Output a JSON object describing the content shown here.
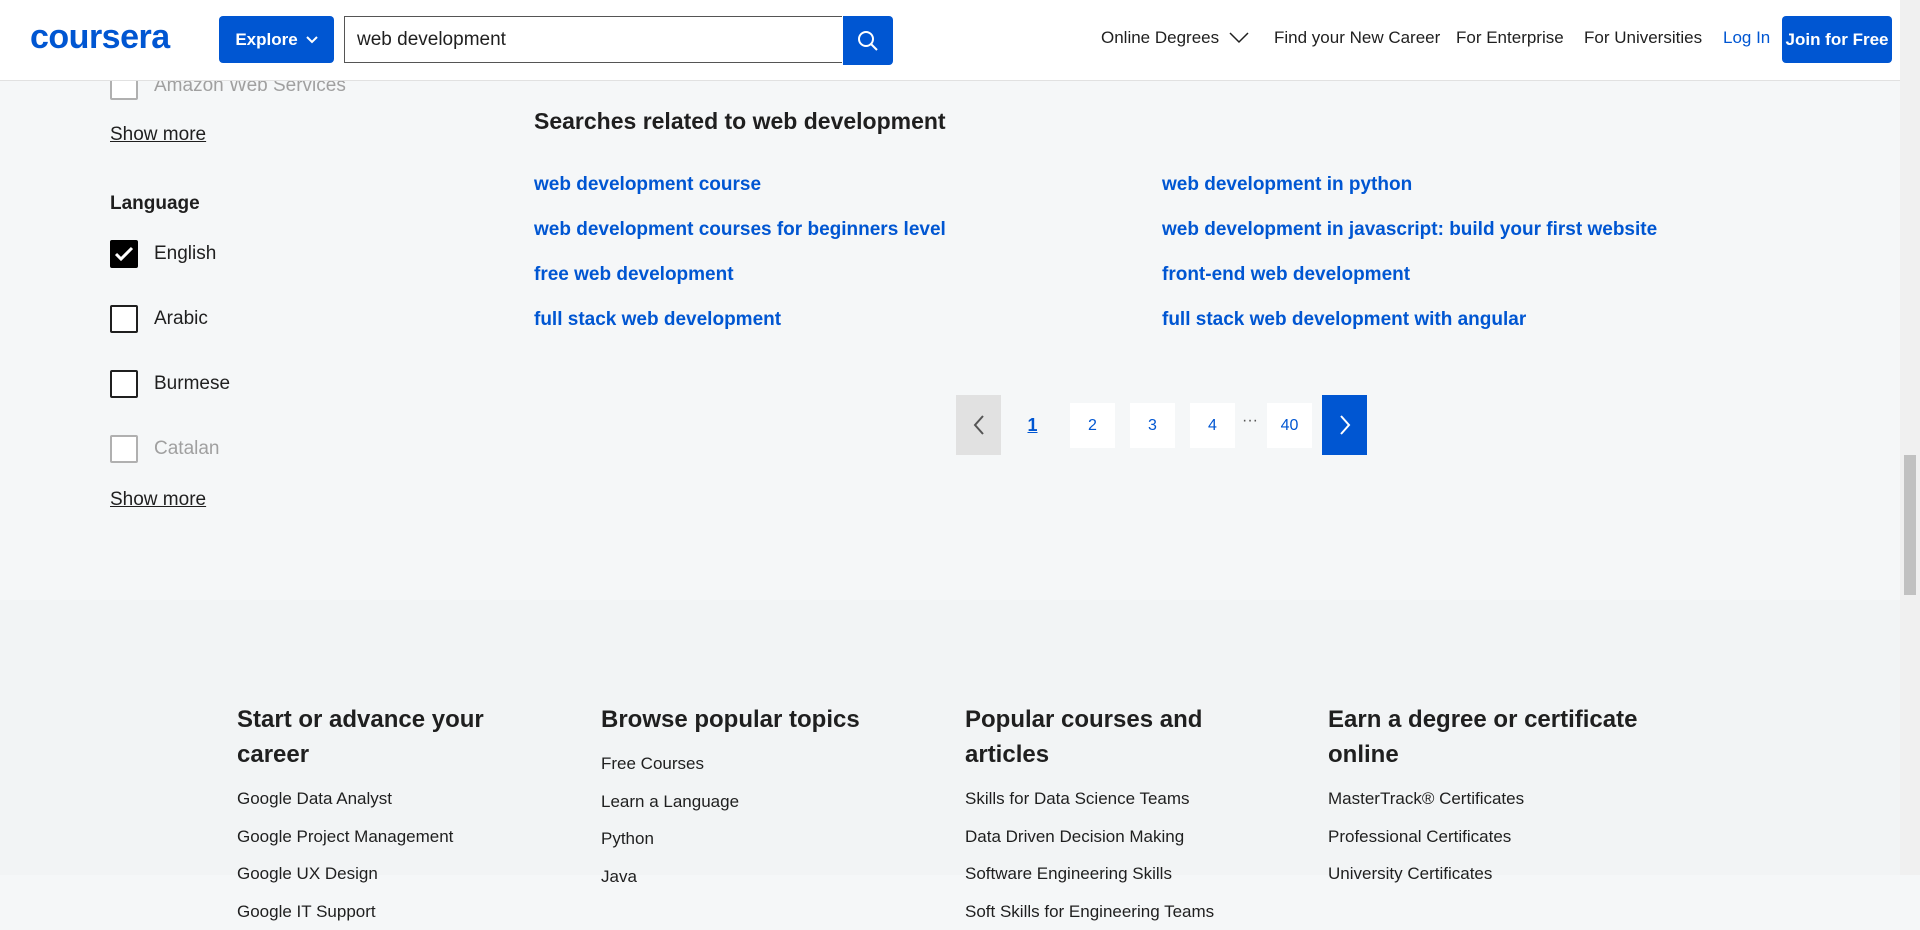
{
  "header": {
    "logo": "coursera",
    "explore_label": "Explore",
    "search_value": "web development",
    "nav": {
      "online_degrees": "Online Degrees",
      "find_career": "Find your New Career",
      "enterprise": "For Enterprise",
      "universities": "For Universities",
      "login": "Log In",
      "join": "Join for Free"
    }
  },
  "sidebar": {
    "partner_partial": "Amazon Web Services",
    "show_more_1": "Show more",
    "language_heading": "Language",
    "languages": [
      {
        "label": "English",
        "checked": true
      },
      {
        "label": "Arabic",
        "checked": false
      },
      {
        "label": "Burmese",
        "checked": false
      },
      {
        "label": "Catalan",
        "checked": false
      }
    ],
    "show_more_2": "Show more"
  },
  "related": {
    "title": "Searches related to web development",
    "left": [
      "web development course",
      "web development courses for beginners level",
      "free web development",
      "full stack web development"
    ],
    "right": [
      "web development in python",
      "web development in javascript: build your first website",
      "front-end web development",
      "full stack web development with angular"
    ]
  },
  "pagination": {
    "pages": [
      "1",
      "2",
      "3",
      "4"
    ],
    "ellipsis": "···",
    "last": "40",
    "current": "1"
  },
  "footer": {
    "columns": [
      {
        "title": "Start or advance your career",
        "links": [
          "Google Data Analyst",
          "Google Project Management",
          "Google UX Design",
          "Google IT Support"
        ]
      },
      {
        "title": "Browse popular topics",
        "links": [
          "Free Courses",
          "Learn a Language",
          "Python",
          "Java"
        ]
      },
      {
        "title": "Popular courses and articles",
        "links": [
          "Skills for Data Science Teams",
          "Data Driven Decision Making",
          "Software Engineering Skills",
          "Soft Skills for Engineering Teams"
        ]
      },
      {
        "title": "Earn a degree or certificate online",
        "links": [
          "MasterTrack® Certificates",
          "Professional Certificates",
          "University Certificates"
        ]
      }
    ]
  },
  "colors": {
    "brand": "#0056d2",
    "text": "#1f1f1f",
    "background": "#f5f7f8"
  }
}
